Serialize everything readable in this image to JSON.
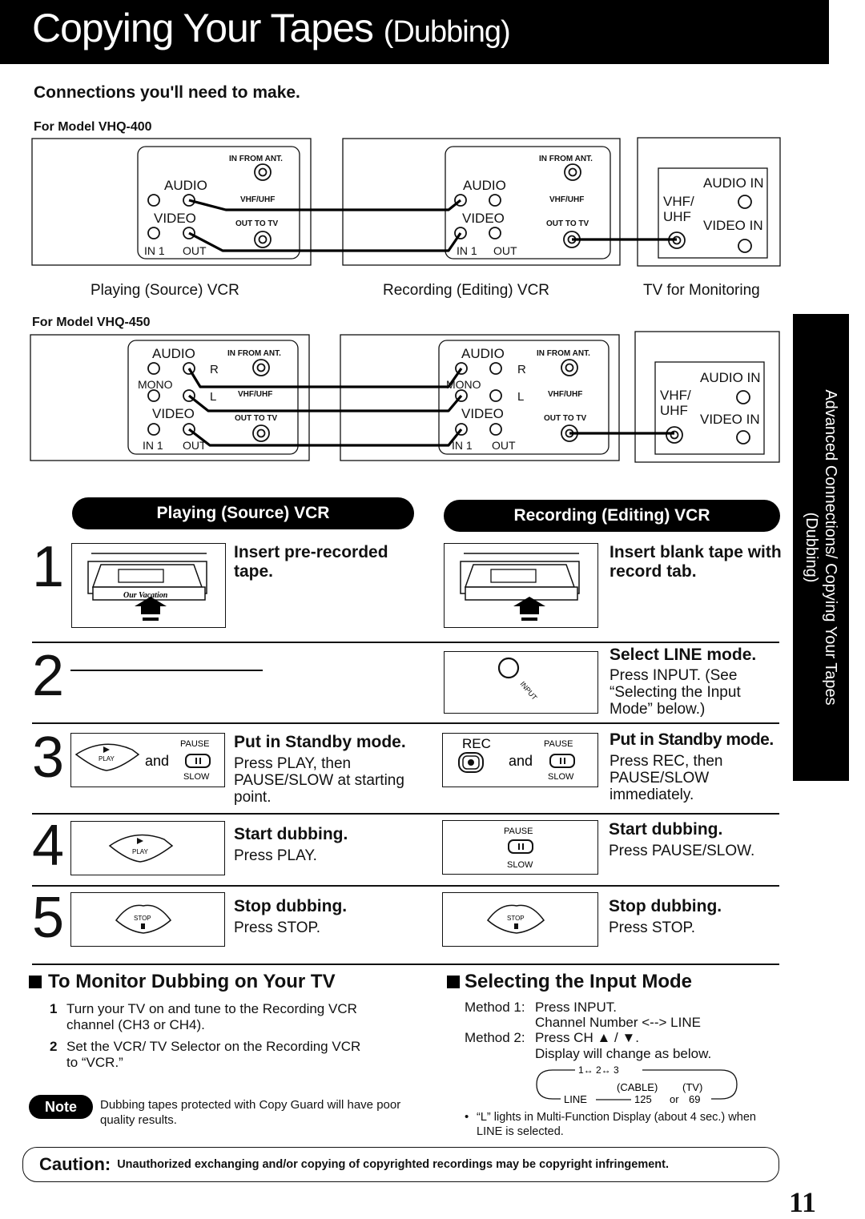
{
  "header": {
    "title_main": "Copying Your Tapes",
    "title_paren": "(Dubbing)"
  },
  "connections": {
    "heading": "Connections you'll need to make.",
    "models": [
      {
        "label": "For Model VHQ-400",
        "source_panel": {
          "audio": "AUDIO",
          "video": "VIDEO",
          "in1": "IN 1",
          "out": "OUT",
          "in_from_ant": "IN FROM ANT.",
          "vhf_uhf": "VHF/UHF",
          "out_to_tv": "OUT TO TV"
        },
        "recording_panel": {
          "audio": "AUDIO",
          "video": "VIDEO",
          "in1": "IN 1",
          "out": "OUT",
          "in_from_ant": "IN FROM ANT.",
          "vhf_uhf": "VHF/UHF",
          "out_to_tv": "OUT TO TV"
        },
        "tv_panel": {
          "audio_in": "AUDIO IN",
          "video_in": "VIDEO IN",
          "vhf": "VHF/",
          "uhf": "UHF"
        }
      },
      {
        "label": "For Model VHQ-450",
        "source_panel": {
          "audio": "AUDIO",
          "mono": "MONO",
          "video": "VIDEO",
          "in1": "IN 1",
          "out": "OUT",
          "r": "R",
          "l": "L",
          "in_from_ant": "IN FROM ANT.",
          "vhf_uhf": "VHF/UHF",
          "out_to_tv": "OUT TO TV"
        },
        "recording_panel": {
          "audio": "AUDIO",
          "mono": "MONO",
          "video": "VIDEO",
          "in1": "IN 1",
          "out": "OUT",
          "r": "R",
          "l": "L",
          "in_from_ant": "IN FROM ANT.",
          "vhf_uhf": "VHF/UHF",
          "out_to_tv": "OUT TO TV"
        },
        "tv_panel": {
          "audio_in": "AUDIO IN",
          "video_in": "VIDEO IN",
          "vhf": "VHF/",
          "uhf": "UHF"
        }
      }
    ],
    "captions": {
      "source": "Playing (Source) VCR",
      "recording": "Recording (Editing) VCR",
      "tv": "TV for Monitoring"
    }
  },
  "columns": {
    "source": "Playing (Source) VCR",
    "recording": "Recording (Editing) VCR"
  },
  "steps": [
    {
      "number": "1",
      "source": {
        "title": "Insert pre-recorded tape.",
        "tape_label": "Our Vacation"
      },
      "recording": {
        "title": "Insert blank tape with record tab."
      }
    },
    {
      "number": "2",
      "recording": {
        "title": "Select LINE mode.",
        "text": "Press INPUT. (See “Selecting the Input Mode” below.)",
        "button_label": "INPUT"
      }
    },
    {
      "number": "3",
      "source": {
        "title": "Put in Standby mode.",
        "text": "Press PLAY, then PAUSE/SLOW at starting point.",
        "btn1": "PLAY",
        "and": "and",
        "pause": "PAUSE",
        "slow": "SLOW"
      },
      "recording": {
        "title": "Put in Standby mode.",
        "text": "Press REC, then PAUSE/SLOW immediately.",
        "rec": "REC",
        "and": "and",
        "pause": "PAUSE",
        "slow": "SLOW"
      }
    },
    {
      "number": "4",
      "source": {
        "title": "Start dubbing.",
        "text": "Press PLAY.",
        "btn": "PLAY"
      },
      "recording": {
        "title": "Start dubbing.",
        "text": "Press PAUSE/SLOW.",
        "pause": "PAUSE",
        "slow": "SLOW"
      }
    },
    {
      "number": "5",
      "source": {
        "title": "Stop dubbing.",
        "text": "Press STOP.",
        "btn": "STOP"
      },
      "recording": {
        "title": "Stop dubbing.",
        "text": "Press STOP.",
        "btn": "STOP"
      }
    }
  ],
  "side_tab": {
    "line1": "Advanced Connections/ Copying Your Tapes",
    "line2": "(Dubbing)"
  },
  "monitor": {
    "title": "To Monitor Dubbing on Your TV",
    "items": [
      {
        "num": "1",
        "text": "Turn your TV on and tune to the Recording VCR channel (CH3 or CH4)."
      },
      {
        "num": "2",
        "text": "Set the VCR/ TV Selector on the Recording VCR to “VCR.”"
      }
    ],
    "note_label": "Note",
    "note_text": "Dubbing tapes protected with Copy Guard will have poor quality results."
  },
  "input_mode": {
    "title": "Selecting the Input Mode",
    "method1_label": "Method 1:",
    "method1_line1": "Press INPUT.",
    "method1_line2": "Channel Number <--> LINE",
    "method2_label": "Method 2:",
    "method2_line1": "Press CH ▲ / ▼.",
    "method2_line2": "Display will change as below.",
    "cycle": {
      "top": "1↔ 2↔ 3",
      "cable": "(CABLE)",
      "tv": "(TV)",
      "line": "LINE",
      "ch125": "125",
      "or": "or",
      "ch69": "69"
    },
    "bullet": "“L” lights in Multi-Function Display (about 4 sec.) when LINE is selected."
  },
  "caution": {
    "label": "Caution:",
    "text": "Unauthorized exchanging and/or copying of copyrighted recordings may be copyright infringement."
  },
  "page_number": "11"
}
